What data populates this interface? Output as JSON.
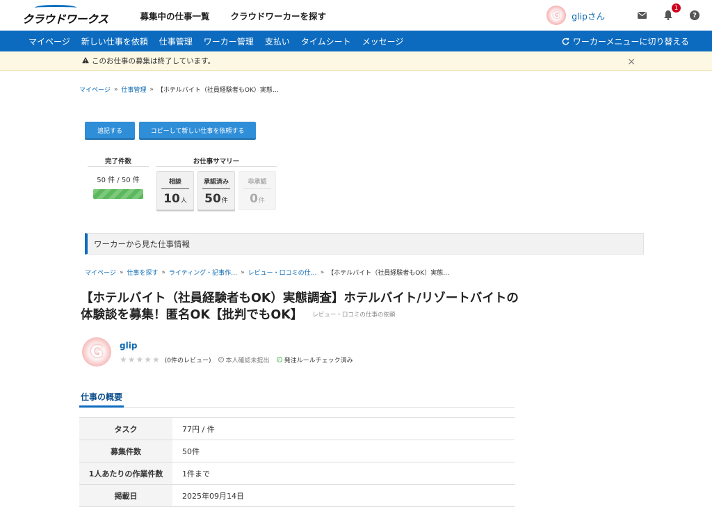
{
  "header": {
    "logo_text": "クラウドワークス",
    "links": [
      "募集中の仕事一覧",
      "クラウドワーカーを探す"
    ],
    "avatar_letter": "G",
    "user_name": "glipさん",
    "notification_count": "1",
    "help_symbol": "?"
  },
  "nav": {
    "items": [
      "マイページ",
      "新しい仕事を依頼",
      "仕事管理",
      "ワーカー管理",
      "支払い",
      "タイムシート",
      "メッセージ"
    ],
    "switch_label": "ワーカーメニューに切り替える"
  },
  "alert": {
    "message": "このお仕事の募集は終了しています。",
    "close": "×"
  },
  "breadcrumb": {
    "items": [
      "マイページ",
      "仕事管理"
    ],
    "current": "【ホテルバイト（社員経験者もOK）実態…"
  },
  "buttons": {
    "add": "追記する",
    "copy": "コピーして新しい仕事を依頼する"
  },
  "stats": {
    "completed_title": "完了件数",
    "completed_value": "50 件 / 50 件",
    "completed_progress_percent": 100,
    "summary_title": "お仕事サマリー",
    "boxes": [
      {
        "label": "相談",
        "num": "10",
        "unit": "人"
      },
      {
        "label": "承認済み",
        "num": "50",
        "unit": "件"
      },
      {
        "label": "非承認",
        "num": "0",
        "unit": "件"
      }
    ]
  },
  "section_title": "ワーカーから見た仕事情報",
  "breadcrumb2": {
    "items": [
      "マイページ",
      "仕事を探す",
      "ライティング・記事作…",
      "レビュー・口コミの仕…"
    ],
    "current": "【ホテルバイト（社員経験者もOK）実態…"
  },
  "job": {
    "title": "【ホテルバイト（社員経験者もOK）実態調査】ホテルバイト/リゾートバイトの体験談を募集！匿名OK【批判でもOK】",
    "category": "レビュー・口コミの仕事の依頼"
  },
  "owner": {
    "avatar_letter": "G",
    "name": "glip",
    "stars": "★★★★★",
    "reviews": "(0件のレビュー)",
    "identity": "本人確認未提出",
    "rules": "発注ルールチェック済み"
  },
  "overview": {
    "title": "仕事の概要",
    "rows": [
      {
        "key": "タスク",
        "value": "77円 / 件"
      },
      {
        "key": "募集件数",
        "value": "50件"
      },
      {
        "key": "1人あたりの作業件数",
        "value": "1件まで"
      },
      {
        "key": "掲載日",
        "value": "2025年09月14日"
      }
    ]
  }
}
